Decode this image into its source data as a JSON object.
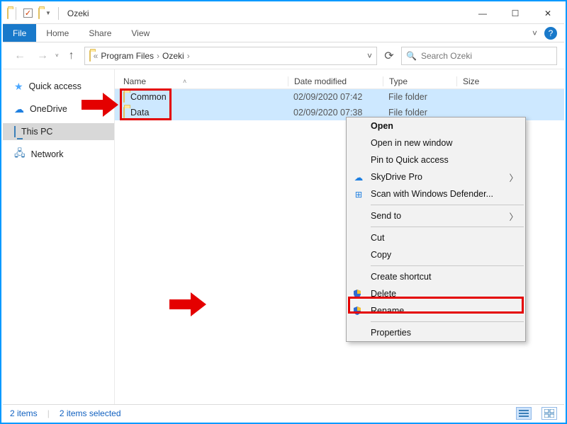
{
  "window": {
    "title": "Ozeki",
    "min": "—",
    "max": "☐",
    "close": "✕"
  },
  "ribbon": {
    "file": "File",
    "tabs": [
      "Home",
      "Share",
      "View"
    ],
    "expand": "˅"
  },
  "nav": {
    "back": "←",
    "forward": "→",
    "up": "↑",
    "refresh": "⟳",
    "drop": "˅"
  },
  "breadcrumb": {
    "root_sep": "«",
    "items": [
      "Program Files",
      "Ozeki"
    ],
    "sep": "›",
    "trail": "›"
  },
  "search": {
    "icon": "🔍",
    "placeholder": "Search Ozeki"
  },
  "navpane": {
    "quick": "Quick access",
    "onedrive": "OneDrive",
    "thispc": "This PC",
    "network": "Network"
  },
  "columns": {
    "name": "Name",
    "date": "Date modified",
    "type": "Type",
    "size": "Size",
    "sort": "˄"
  },
  "rows": [
    {
      "name": "Common",
      "date": "02/09/2020 07:42",
      "type": "File folder",
      "size": ""
    },
    {
      "name": "Data",
      "date": "02/09/2020 07:38",
      "type": "File folder",
      "size": ""
    }
  ],
  "context_menu": {
    "open": "Open",
    "open_new": "Open in new window",
    "pin": "Pin to Quick access",
    "skydrive": "SkyDrive Pro",
    "defender": "Scan with Windows Defender...",
    "sendto": "Send to",
    "cut": "Cut",
    "copy": "Copy",
    "shortcut": "Create shortcut",
    "delete": "Delete",
    "rename": "Rename",
    "properties": "Properties",
    "arrow": "〉"
  },
  "status": {
    "count": "2 items",
    "selected": "2 items selected"
  }
}
